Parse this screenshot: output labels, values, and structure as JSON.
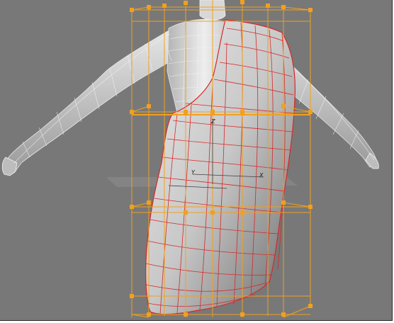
{
  "viewport": {
    "background": "#787878",
    "gizmo_axes": {
      "x": "X",
      "y": "Y",
      "z": "Z"
    },
    "colors": {
      "lattice": "#f0a020",
      "mesh_wire": "#e8e8e8",
      "cloth_wire": "#d82828",
      "figure_fill": "#c9c9c9",
      "cloth_fill": "#d0cfcf",
      "ground_plane": "#a8a8a8"
    },
    "objects": [
      {
        "name": "mannequin-body",
        "icon": "body-mesh"
      },
      {
        "name": "draped-cloth",
        "icon": "cloth-mesh"
      },
      {
        "name": "ffd-lattice",
        "icon": "lattice-cage"
      },
      {
        "name": "move-gizmo",
        "icon": "transform-gizmo"
      }
    ]
  }
}
